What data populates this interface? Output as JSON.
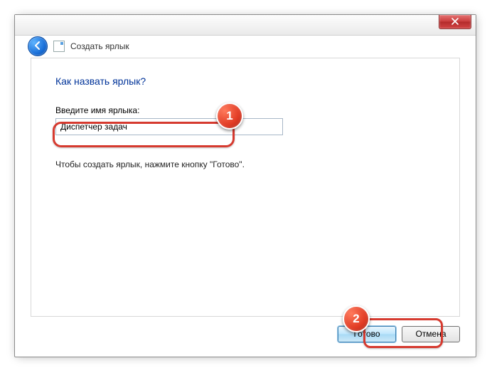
{
  "dialog": {
    "title": "Создать ярлык",
    "heading": "Как назвать ярлык?",
    "field_label": "Введите имя ярлыка:",
    "hint": "Чтобы создать ярлык, нажмите кнопку \"Готово\"."
  },
  "shortcut_name": {
    "value": "Диспетчер задач"
  },
  "buttons": {
    "finish": "Готово",
    "cancel": "Отмена"
  },
  "annotations": {
    "step1": "1",
    "step2": "2"
  }
}
